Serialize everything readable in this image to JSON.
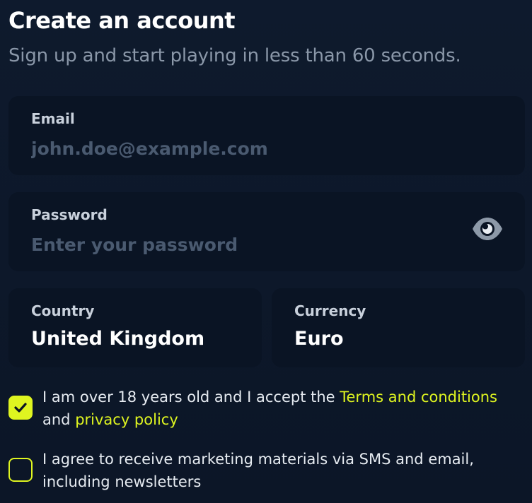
{
  "header": {
    "title": "Create an account",
    "subtitle": "Sign up and start playing in less than 60 seconds."
  },
  "form": {
    "email": {
      "label": "Email",
      "value": "",
      "placeholder": "john.doe@example.com"
    },
    "password": {
      "label": "Password",
      "value": "",
      "placeholder": "Enter your password",
      "toggle_icon": "eye-icon"
    },
    "country": {
      "label": "Country",
      "value": "United Kingdom"
    },
    "currency": {
      "label": "Currency",
      "value": "Euro"
    }
  },
  "consents": {
    "age": {
      "checked": true,
      "text_before": "I am over 18 years old and I accept the ",
      "terms_link": "Terms and conditions",
      "text_middle": " and ",
      "privacy_link": "privacy policy"
    },
    "marketing": {
      "checked": false,
      "text": "I agree to receive marketing materials via SMS and email, including newsletters"
    }
  },
  "colors": {
    "accent": "#dff520",
    "background": "#0e1a2d",
    "field_background": "#0a1424",
    "muted_text": "#8a97a8",
    "placeholder": "#4a5a70"
  }
}
